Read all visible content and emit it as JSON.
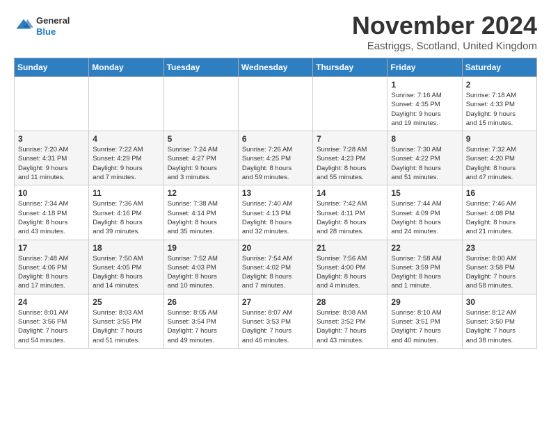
{
  "header": {
    "logo_general": "General",
    "logo_blue": "Blue",
    "month_title": "November 2024",
    "subtitle": "Eastriggs, Scotland, United Kingdom"
  },
  "weekdays": [
    "Sunday",
    "Monday",
    "Tuesday",
    "Wednesday",
    "Thursday",
    "Friday",
    "Saturday"
  ],
  "weeks": [
    [
      {
        "day": "",
        "detail": ""
      },
      {
        "day": "",
        "detail": ""
      },
      {
        "day": "",
        "detail": ""
      },
      {
        "day": "",
        "detail": ""
      },
      {
        "day": "",
        "detail": ""
      },
      {
        "day": "1",
        "detail": "Sunrise: 7:16 AM\nSunset: 4:35 PM\nDaylight: 9 hours\nand 19 minutes."
      },
      {
        "day": "2",
        "detail": "Sunrise: 7:18 AM\nSunset: 4:33 PM\nDaylight: 9 hours\nand 15 minutes."
      }
    ],
    [
      {
        "day": "3",
        "detail": "Sunrise: 7:20 AM\nSunset: 4:31 PM\nDaylight: 9 hours\nand 11 minutes."
      },
      {
        "day": "4",
        "detail": "Sunrise: 7:22 AM\nSunset: 4:29 PM\nDaylight: 9 hours\nand 7 minutes."
      },
      {
        "day": "5",
        "detail": "Sunrise: 7:24 AM\nSunset: 4:27 PM\nDaylight: 9 hours\nand 3 minutes."
      },
      {
        "day": "6",
        "detail": "Sunrise: 7:26 AM\nSunset: 4:25 PM\nDaylight: 8 hours\nand 59 minutes."
      },
      {
        "day": "7",
        "detail": "Sunrise: 7:28 AM\nSunset: 4:23 PM\nDaylight: 8 hours\nand 55 minutes."
      },
      {
        "day": "8",
        "detail": "Sunrise: 7:30 AM\nSunset: 4:22 PM\nDaylight: 8 hours\nand 51 minutes."
      },
      {
        "day": "9",
        "detail": "Sunrise: 7:32 AM\nSunset: 4:20 PM\nDaylight: 8 hours\nand 47 minutes."
      }
    ],
    [
      {
        "day": "10",
        "detail": "Sunrise: 7:34 AM\nSunset: 4:18 PM\nDaylight: 8 hours\nand 43 minutes."
      },
      {
        "day": "11",
        "detail": "Sunrise: 7:36 AM\nSunset: 4:16 PM\nDaylight: 8 hours\nand 39 minutes."
      },
      {
        "day": "12",
        "detail": "Sunrise: 7:38 AM\nSunset: 4:14 PM\nDaylight: 8 hours\nand 35 minutes."
      },
      {
        "day": "13",
        "detail": "Sunrise: 7:40 AM\nSunset: 4:13 PM\nDaylight: 8 hours\nand 32 minutes."
      },
      {
        "day": "14",
        "detail": "Sunrise: 7:42 AM\nSunset: 4:11 PM\nDaylight: 8 hours\nand 28 minutes."
      },
      {
        "day": "15",
        "detail": "Sunrise: 7:44 AM\nSunset: 4:09 PM\nDaylight: 8 hours\nand 24 minutes."
      },
      {
        "day": "16",
        "detail": "Sunrise: 7:46 AM\nSunset: 4:08 PM\nDaylight: 8 hours\nand 21 minutes."
      }
    ],
    [
      {
        "day": "17",
        "detail": "Sunrise: 7:48 AM\nSunset: 4:06 PM\nDaylight: 8 hours\nand 17 minutes."
      },
      {
        "day": "18",
        "detail": "Sunrise: 7:50 AM\nSunset: 4:05 PM\nDaylight: 8 hours\nand 14 minutes."
      },
      {
        "day": "19",
        "detail": "Sunrise: 7:52 AM\nSunset: 4:03 PM\nDaylight: 8 hours\nand 10 minutes."
      },
      {
        "day": "20",
        "detail": "Sunrise: 7:54 AM\nSunset: 4:02 PM\nDaylight: 8 hours\nand 7 minutes."
      },
      {
        "day": "21",
        "detail": "Sunrise: 7:56 AM\nSunset: 4:00 PM\nDaylight: 8 hours\nand 4 minutes."
      },
      {
        "day": "22",
        "detail": "Sunrise: 7:58 AM\nSunset: 3:59 PM\nDaylight: 8 hours\nand 1 minute."
      },
      {
        "day": "23",
        "detail": "Sunrise: 8:00 AM\nSunset: 3:58 PM\nDaylight: 7 hours\nand 58 minutes."
      }
    ],
    [
      {
        "day": "24",
        "detail": "Sunrise: 8:01 AM\nSunset: 3:56 PM\nDaylight: 7 hours\nand 54 minutes."
      },
      {
        "day": "25",
        "detail": "Sunrise: 8:03 AM\nSunset: 3:55 PM\nDaylight: 7 hours\nand 51 minutes."
      },
      {
        "day": "26",
        "detail": "Sunrise: 8:05 AM\nSunset: 3:54 PM\nDaylight: 7 hours\nand 49 minutes."
      },
      {
        "day": "27",
        "detail": "Sunrise: 8:07 AM\nSunset: 3:53 PM\nDaylight: 7 hours\nand 46 minutes."
      },
      {
        "day": "28",
        "detail": "Sunrise: 8:08 AM\nSunset: 3:52 PM\nDaylight: 7 hours\nand 43 minutes."
      },
      {
        "day": "29",
        "detail": "Sunrise: 8:10 AM\nSunset: 3:51 PM\nDaylight: 7 hours\nand 40 minutes."
      },
      {
        "day": "30",
        "detail": "Sunrise: 8:12 AM\nSunset: 3:50 PM\nDaylight: 7 hours\nand 38 minutes."
      }
    ]
  ]
}
